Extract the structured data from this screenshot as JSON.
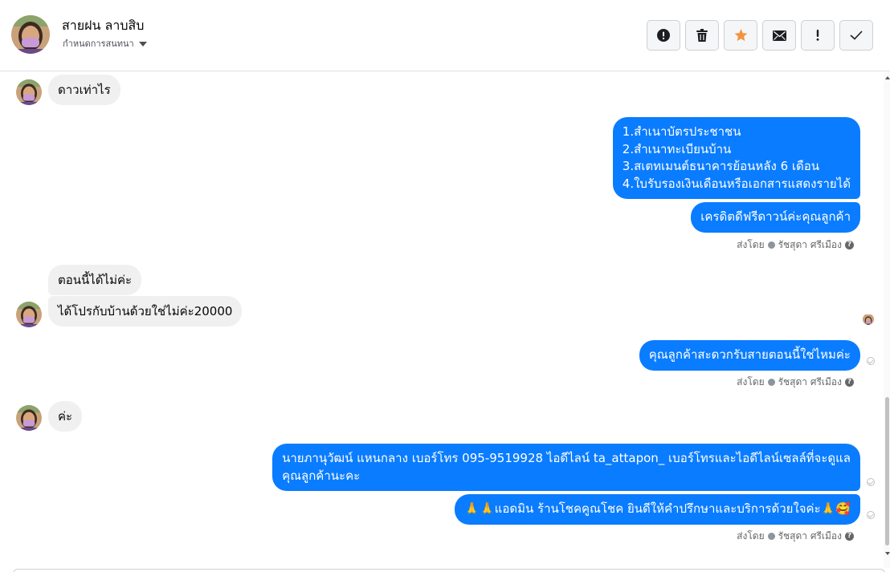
{
  "header": {
    "contact_name": "สายฝน ลาบสิบ",
    "subtitle": "กำหนดการสนทนา"
  },
  "toolbar": {
    "buttons": [
      {
        "name": "report-icon"
      },
      {
        "name": "trash-icon"
      },
      {
        "name": "star-icon"
      },
      {
        "name": "mail-icon"
      },
      {
        "name": "exclamation-icon"
      },
      {
        "name": "checkmark-icon"
      }
    ],
    "star_color": "#f7923a"
  },
  "messages": {
    "m1": "ดาวเท่าไร",
    "m2_lines": [
      "1.สำเนาบัตรประชาชน",
      "2.สำเนาทะเบียนบ้าน",
      "3.สเตทเมนต์ธนาคารย้อนหลัง 6 เดือน",
      "4.ใบรับรองเงินเดือนหรือเอกสารแสดงรายได้"
    ],
    "m3": "เครดิตดีฟรีดาวน์ค่ะคุณลูกค้า",
    "m4": "ตอนนี้ได้ไม่ค่ะ",
    "m5": "ได้โปรกับบ้านด้วยใช่ไม่ค่ะ20000",
    "m6": "คุณลูกค้าสะดวกรับสายตอนนี้ใช่ไหมค่ะ",
    "m7": "ค่ะ",
    "m8_lines": [
      "นายภานุวัฒน์ แหนกลาง เบอร์โทร 095-9519928 ไอดีไลน์ ta_attapon_  เบอร์โทรและไอดีไลน์เซลล์ที่จะดูแล",
      "คุณลูกค้านะคะ"
    ],
    "m9": "🙏🙏แอดมิน ร้านโชคคูณโชค ยินดีให้คำปรึกษาและบริการด้วยใจค่ะ🙏🥰"
  },
  "sent_by": {
    "prefix": "ส่งโดย",
    "agent": "รัชสุดา ศรีเมือง"
  },
  "colors": {
    "outgoing_bubble": "#0a7cff",
    "incoming_bubble": "#f0f0f0"
  }
}
